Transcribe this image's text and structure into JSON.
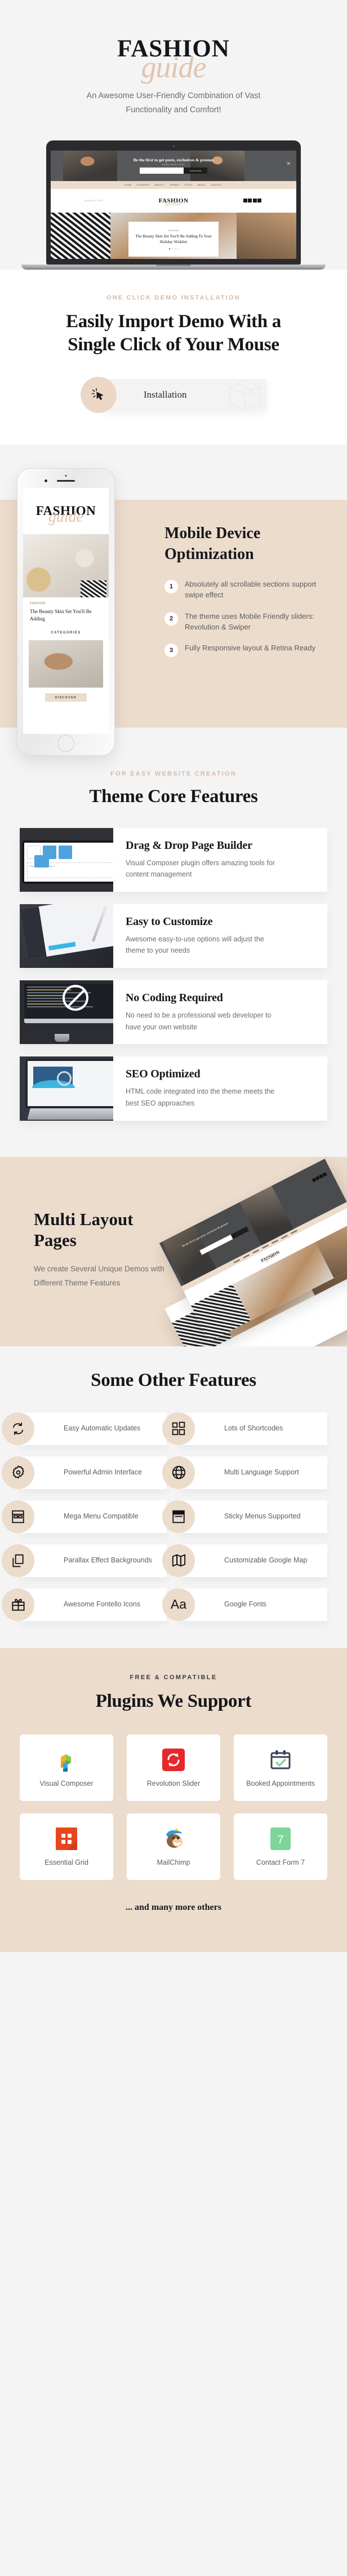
{
  "hero": {
    "brand_primary": "FASHION",
    "brand_script": "guide",
    "subtitle": "An Awesome User-Friendly Combination of Vast Functionality and Comfort!",
    "laptop_preview": {
      "promo_title": "Be the first to get posts, exclusives & promos",
      "promo_sub": "NEVER MISS A POST",
      "email_placeholder": "Your Email",
      "subscribe_label": "SUBSCRIBE",
      "close_icon": "close-icon",
      "nav": [
        "HOME",
        "ELEMENTS",
        "BEAUTY",
        "TRENDS",
        "STYLE",
        "ABOUT",
        "CONTACT"
      ],
      "search_label": "SEARCH A POST",
      "logo_primary": "FASHION",
      "logo_script": "guide",
      "post_category": "FASHION",
      "post_date": "05.1.18",
      "post_title": "The Beauty Skin Set You'll Be Adding To Your Holiday Wishlist"
    }
  },
  "demo": {
    "eyebrow": "ONE CLICK DEMO INSTALLATION",
    "title": "Easily Import Demo With a Single Click of Your Mouse",
    "button_label": "Installation",
    "cursor_icon": "click-cursor-icon",
    "box_icon": "package-box-icon"
  },
  "mobile": {
    "title": "Mobile Device Optimization",
    "items": [
      {
        "num": "1",
        "text": "Absolutely all scrollable sections support swipe effect"
      },
      {
        "num": "2",
        "text": "The theme uses Mobile Friendly sliders: Revolution & Swiper"
      },
      {
        "num": "3",
        "text": "Fully Responsive layout & Retina Ready"
      }
    ],
    "phone_preview": {
      "logo_primary": "FASHION",
      "logo_script": "guide",
      "post_category": "FASHION",
      "post_title": "The Beauty Skin Set You'll Be Adding",
      "categories_label": "CATEGORIES",
      "button_label": "DISCOVER"
    }
  },
  "core": {
    "eyebrow": "FOR EASY WEBSITE CREATION",
    "title": "Theme Core Features",
    "features": [
      {
        "title": "Drag & Drop Page Builder",
        "desc": "Visual Composer plugin offers amazing tools for content management",
        "thumb": "visual-composer-laptop-image",
        "thumb_caption": "Drag here to add widgets"
      },
      {
        "title": "Easy to Customize",
        "desc": "Awesome easy-to-use options will adjust the theme to your needs",
        "thumb": "tablet-stylus-image"
      },
      {
        "title": "No Coding Required",
        "desc": "No need to be a professional web developer to have your own website",
        "thumb": "imac-code-no-entry-image"
      },
      {
        "title": "SEO Optimized",
        "desc": "HTML code integrated into the theme meets the best SEO approaches",
        "thumb": "tablet-seo-chart-image"
      }
    ]
  },
  "multi": {
    "title": "Multi Layout Pages",
    "desc": "We create Several Unique Demos with Different Theme Features",
    "art": "angled-website-screenshots"
  },
  "other": {
    "title": "Some Other Features",
    "items": [
      {
        "label": "Easy Automatic Updates",
        "icon": "refresh-icon"
      },
      {
        "label": "Lots of Shortcodes",
        "icon": "grid-blocks-icon"
      },
      {
        "label": "Powerful Admin Interface",
        "icon": "gear-icon"
      },
      {
        "label": "Multi Language Support",
        "icon": "globe-icon"
      },
      {
        "label": "Mega Menu Compatible",
        "icon": "mega-menu-icon"
      },
      {
        "label": "Sticky Menus Supported",
        "icon": "sticky-menu-icon"
      },
      {
        "label": "Parallax Effect Backgrounds",
        "icon": "layers-icon"
      },
      {
        "label": "Customizable Google Map",
        "icon": "map-icon"
      },
      {
        "label": "Awesome Fontello Icons",
        "icon": "gift-icon"
      },
      {
        "label": "Google Fonts",
        "icon": "typography-aa-icon"
      }
    ]
  },
  "plugins": {
    "eyebrow": "FREE & COMPATIBLE",
    "title": "Plugins We Support",
    "items": [
      {
        "name": "Visual Composer",
        "icon": "visual-composer-logo"
      },
      {
        "name": "Revolution Slider",
        "icon": "revolution-slider-logo"
      },
      {
        "name": "Booked Appointments",
        "icon": "booked-appointments-logo"
      },
      {
        "name": "Essential Grid",
        "icon": "essential-grid-logo"
      },
      {
        "name": "MailChimp",
        "icon": "mailchimp-logo"
      },
      {
        "name": "Contact Form 7",
        "icon": "contact-form-7-logo"
      }
    ],
    "footer_note": "... and many more others"
  },
  "colors": {
    "accent": "#ecdccc",
    "accent_text": "#d7b9a4",
    "page_bg": "#f4f4f4",
    "heading": "#16171b",
    "body_text": "#6e6e6e"
  }
}
